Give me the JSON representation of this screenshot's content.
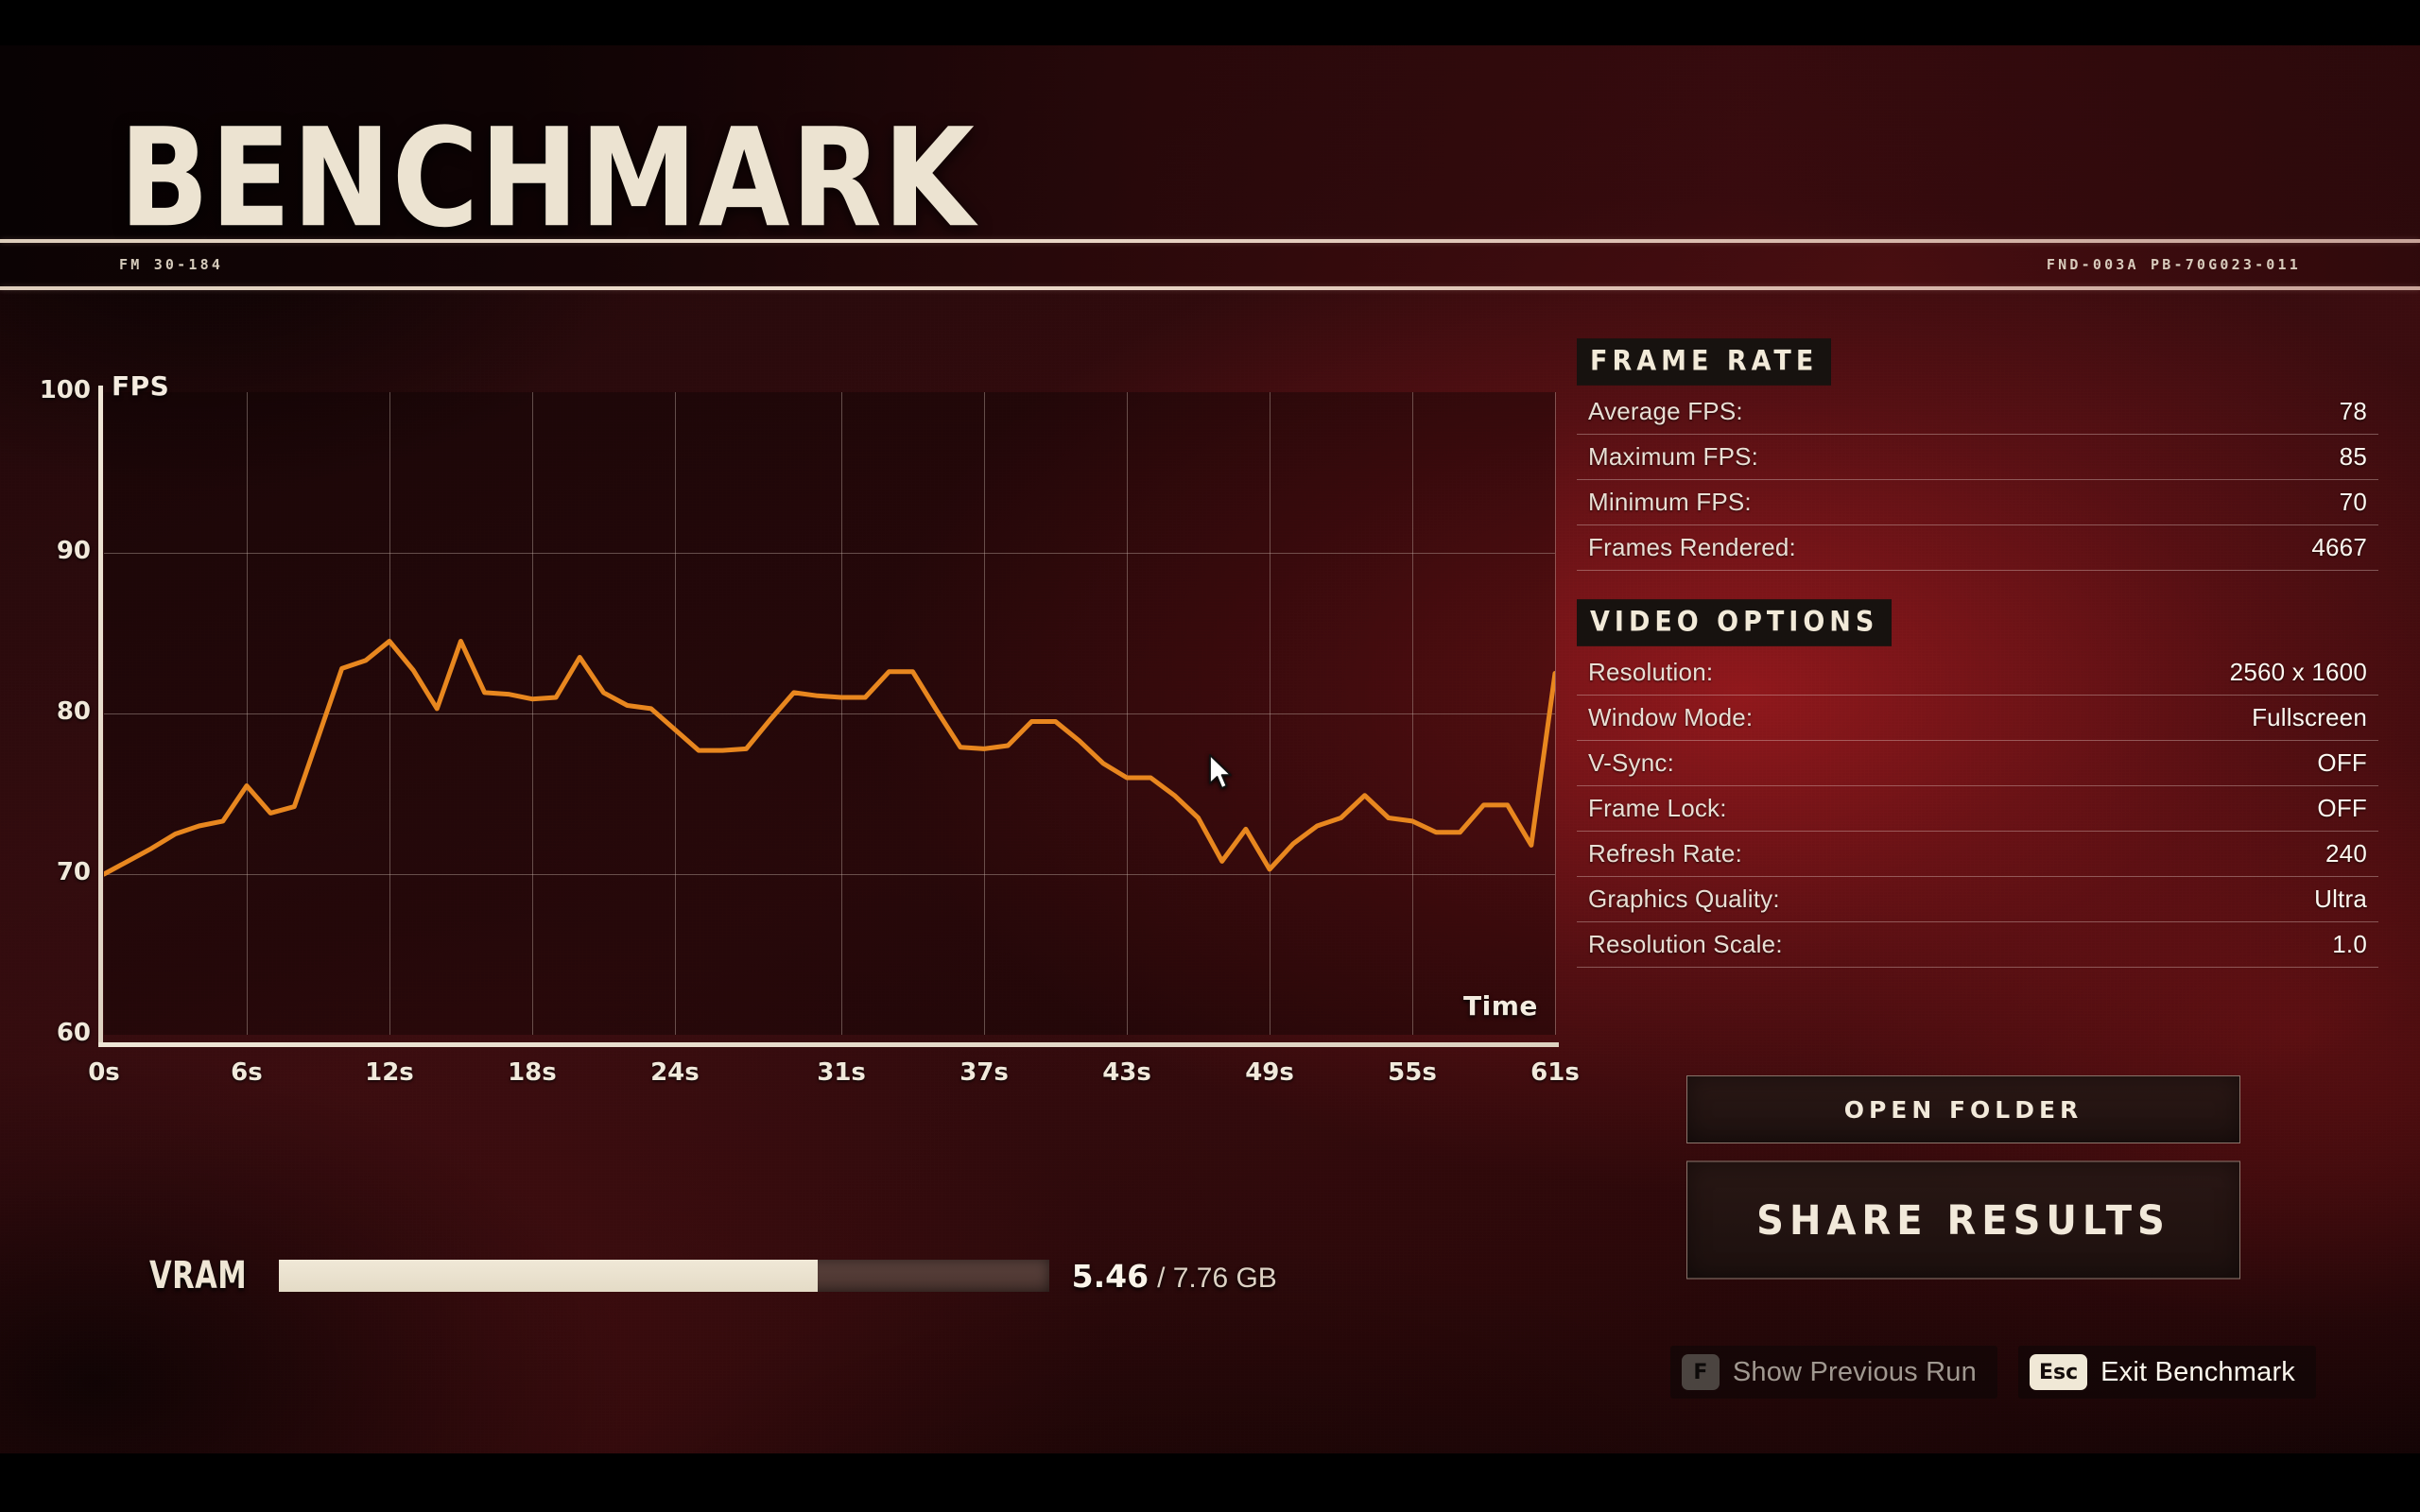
{
  "header": {
    "title": "BENCHMARK",
    "code_left": "FM 30-184",
    "code_right": "FND-003A PB-70G023-011"
  },
  "chart_data": {
    "type": "line",
    "title": "",
    "xlabel": "Time",
    "ylabel": "FPS",
    "ylim": [
      60,
      100
    ],
    "yticks": [
      100,
      90,
      80,
      70,
      60
    ],
    "xticks": [
      "0s",
      "6s",
      "12s",
      "18s",
      "24s",
      "31s",
      "37s",
      "43s",
      "49s",
      "55s",
      "61s"
    ],
    "xlim": [
      0,
      61
    ],
    "grid": true,
    "legend": "none",
    "line_color": "#e8871f",
    "series": [
      {
        "name": "FPS",
        "x": [
          0,
          1,
          2,
          3,
          4,
          5,
          6,
          7,
          8,
          9,
          10,
          11,
          12,
          13,
          14,
          15,
          16,
          17,
          18,
          19,
          20,
          21,
          22,
          23,
          24,
          25,
          26,
          27,
          28,
          29,
          30,
          31,
          32,
          33,
          34,
          35,
          36,
          37,
          38,
          39,
          40,
          41,
          42,
          43,
          44,
          45,
          46,
          47,
          48,
          49,
          50,
          51,
          52,
          53,
          54,
          55,
          56,
          57,
          58,
          59,
          60,
          61
        ],
        "values": [
          70.0,
          70.8,
          71.6,
          72.5,
          73.0,
          73.3,
          75.5,
          73.8,
          74.2,
          78.5,
          82.8,
          83.3,
          84.5,
          82.7,
          80.3,
          84.5,
          81.3,
          81.2,
          80.9,
          81.0,
          83.5,
          81.3,
          80.5,
          80.3,
          79.0,
          77.7,
          77.7,
          77.8,
          79.6,
          81.3,
          81.1,
          81.0,
          81.0,
          82.6,
          82.6,
          80.2,
          77.9,
          77.8,
          78.0,
          79.5,
          79.5,
          78.3,
          76.9,
          76.0,
          76.0,
          74.9,
          73.5,
          70.8,
          72.8,
          70.3,
          71.9,
          73.0,
          73.5,
          74.9,
          73.5,
          73.3,
          72.6,
          72.6,
          74.3,
          74.3,
          71.8,
          82.5
        ]
      }
    ]
  },
  "frame_rate": {
    "heading": "FRAME RATE",
    "rows": [
      {
        "label": "Average FPS:",
        "value": "78"
      },
      {
        "label": "Maximum FPS:",
        "value": "85"
      },
      {
        "label": "Minimum FPS:",
        "value": "70"
      },
      {
        "label": "Frames Rendered:",
        "value": "4667"
      }
    ]
  },
  "video_options": {
    "heading": "VIDEO OPTIONS",
    "rows": [
      {
        "label": "Resolution:",
        "value": "2560 x 1600"
      },
      {
        "label": "Window Mode:",
        "value": "Fullscreen"
      },
      {
        "label": "V-Sync:",
        "value": "OFF"
      },
      {
        "label": "Frame Lock:",
        "value": "OFF"
      },
      {
        "label": "Refresh Rate:",
        "value": "240"
      },
      {
        "label": "Graphics Quality:",
        "value": "Ultra"
      },
      {
        "label": "Resolution Scale:",
        "value": "1.0"
      }
    ]
  },
  "buttons": {
    "open_folder": "OPEN FOLDER",
    "share_results": "SHARE RESULTS"
  },
  "vram": {
    "label": "VRAM",
    "used": "5.46",
    "total": "/ 7.76 GB",
    "used_gb": 5.46,
    "total_gb": 7.76,
    "fill_percent": 70
  },
  "hints": [
    {
      "key": "F",
      "label": "Show Previous Run",
      "state": "disabled"
    },
    {
      "key": "Esc",
      "label": "Exit Benchmark",
      "state": "active"
    }
  ],
  "colors": {
    "accent": "#e8871f",
    "cream": "#ece3d1",
    "panel_red": "#8f171c"
  }
}
